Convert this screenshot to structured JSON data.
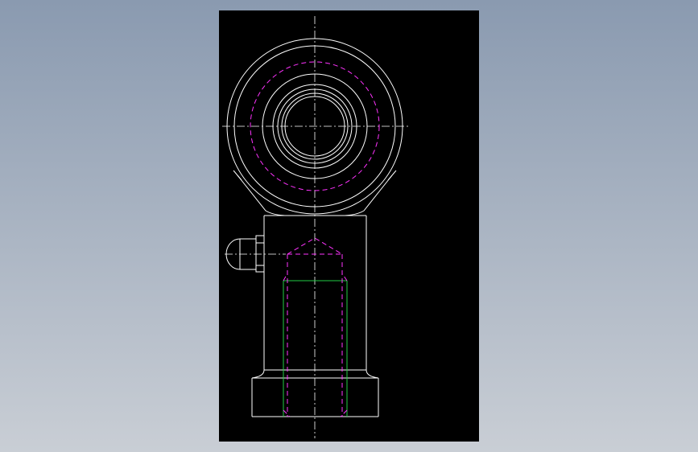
{
  "app": {
    "view": "cad-viewport"
  },
  "colors": {
    "background_top": "#8a9ab0",
    "background_bottom": "#c9ced5",
    "sheet": "#000000",
    "outline": "#ffffff",
    "hidden_line": "#ff33ff",
    "thread_line": "#22cc44",
    "centerline": "#ffffff"
  },
  "drawing": {
    "part": "rod-end-bearing-front-view",
    "layers": [
      {
        "name": "outline",
        "style": "continuous"
      },
      {
        "name": "hidden",
        "style": "dashed"
      },
      {
        "name": "thread",
        "style": "continuous"
      },
      {
        "name": "center",
        "style": "dash-dot"
      }
    ],
    "features": [
      "eye-housing",
      "spherical-ball",
      "bore",
      "neck",
      "shank",
      "grease-nipple",
      "hex-collar",
      "internal-thread",
      "drill-point"
    ]
  }
}
